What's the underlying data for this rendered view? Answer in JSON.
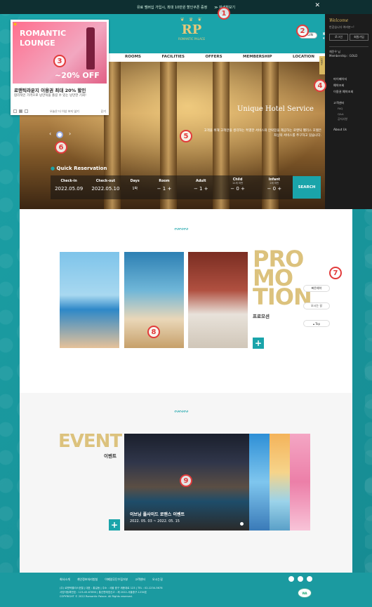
{
  "topbar": {
    "notice": "유료 멤버십 가입시, 최대 10만원 할인쿠폰 증정",
    "link": "≫ 자세히보기"
  },
  "header": {
    "logo": "RP",
    "logo_sub": "ROMANTIC PALACE",
    "login": "LOGIN",
    "lang": "KOR ▾",
    "menu": [
      "ROOMS",
      "FACILITIES",
      "OFFERS",
      "MEMBERSHIP",
      "LOCATION"
    ]
  },
  "popup": {
    "img_line1": "ROMANTIC",
    "img_line2": "LOUNGE",
    "img_offer": "~20% OFF",
    "title": "로맨틱라운지 이용권 최대 20% 할인",
    "desc": "합리적인 가격으로 낭만적을 즐길 수 있는 낭만한 기회!",
    "no_show": "오늘은 더 이상 보지 않기",
    "close": "닫기"
  },
  "hero": {
    "title": "Unique Hotel Service",
    "desc": "고객을 위해 고객만을 생각하는 특별한 서비스와 안락함을 제공하는 로맨틱 팰리스 호텔은 최상의 서비스를 추구하고 있습니다."
  },
  "reservation": {
    "title": "Quick Reservation",
    "checkin_label": "Check-in",
    "checkin": "2022.05.09",
    "checkout_label": "Check-out",
    "checkout": "2022.05.10",
    "days_label": "Days",
    "days": "1박",
    "room_label": "Room",
    "room": "1",
    "adult_label": "Adult",
    "adult": "1",
    "child_label": "Child",
    "child_sub": "12세 미만",
    "child": "0",
    "infant_label": "Infant",
    "infant_sub": "2세 미만",
    "infant": "0",
    "search": "SEARCH"
  },
  "sidebar": {
    "welcome": "Welcome",
    "greet": "반갑습니다 여러분~!",
    "login": "로그인",
    "join": "회원가입",
    "member_name": "채윤우 님",
    "member_grade": "Membership : GOLD",
    "tab": "OPEN",
    "items": [
      "마이페이지",
      "예약조회",
      "이용권 예약조회",
      "고객센터"
    ],
    "sub_items": [
      "FAQ",
      "Q&A",
      "공지사항"
    ],
    "about": "About Us"
  },
  "promotion": {
    "big1": "PRO",
    "big2": "MO",
    "big3": "TION",
    "ko": "프로모션",
    "plus": "+"
  },
  "quick_links": [
    "빠른예약",
    "오시는 길",
    "Top"
  ],
  "event": {
    "big": "EVENT",
    "ko": "이벤트",
    "caption": "이브닝 풀사이드 로맨스 이벤트",
    "period": "2022. 05. 03 ~ 2022. 05. 15",
    "plus": "+"
  },
  "footer": {
    "links": [
      "회사소개",
      "개인정보처리방침",
      "이메일무단수집거부",
      "고객센터",
      "오시는길"
    ],
    "info1": "(주) 로맨틱팰리스호텔 | 대표 : 홍길동 | 주소 : 서울 중구 세종대로 123 | TEL : 02-1234-5678",
    "info2": "사업자등록번호 : 123-45-67890 | 통신판매업신고 : 제 2022-서울중구-1234호",
    "info3": "COPYRIGHT © 2022 Romantic Palace. All Rights reserved.",
    "badge": "WA"
  },
  "markers": [
    "1",
    "2",
    "3",
    "4",
    "5",
    "6",
    "7",
    "8",
    "9"
  ]
}
